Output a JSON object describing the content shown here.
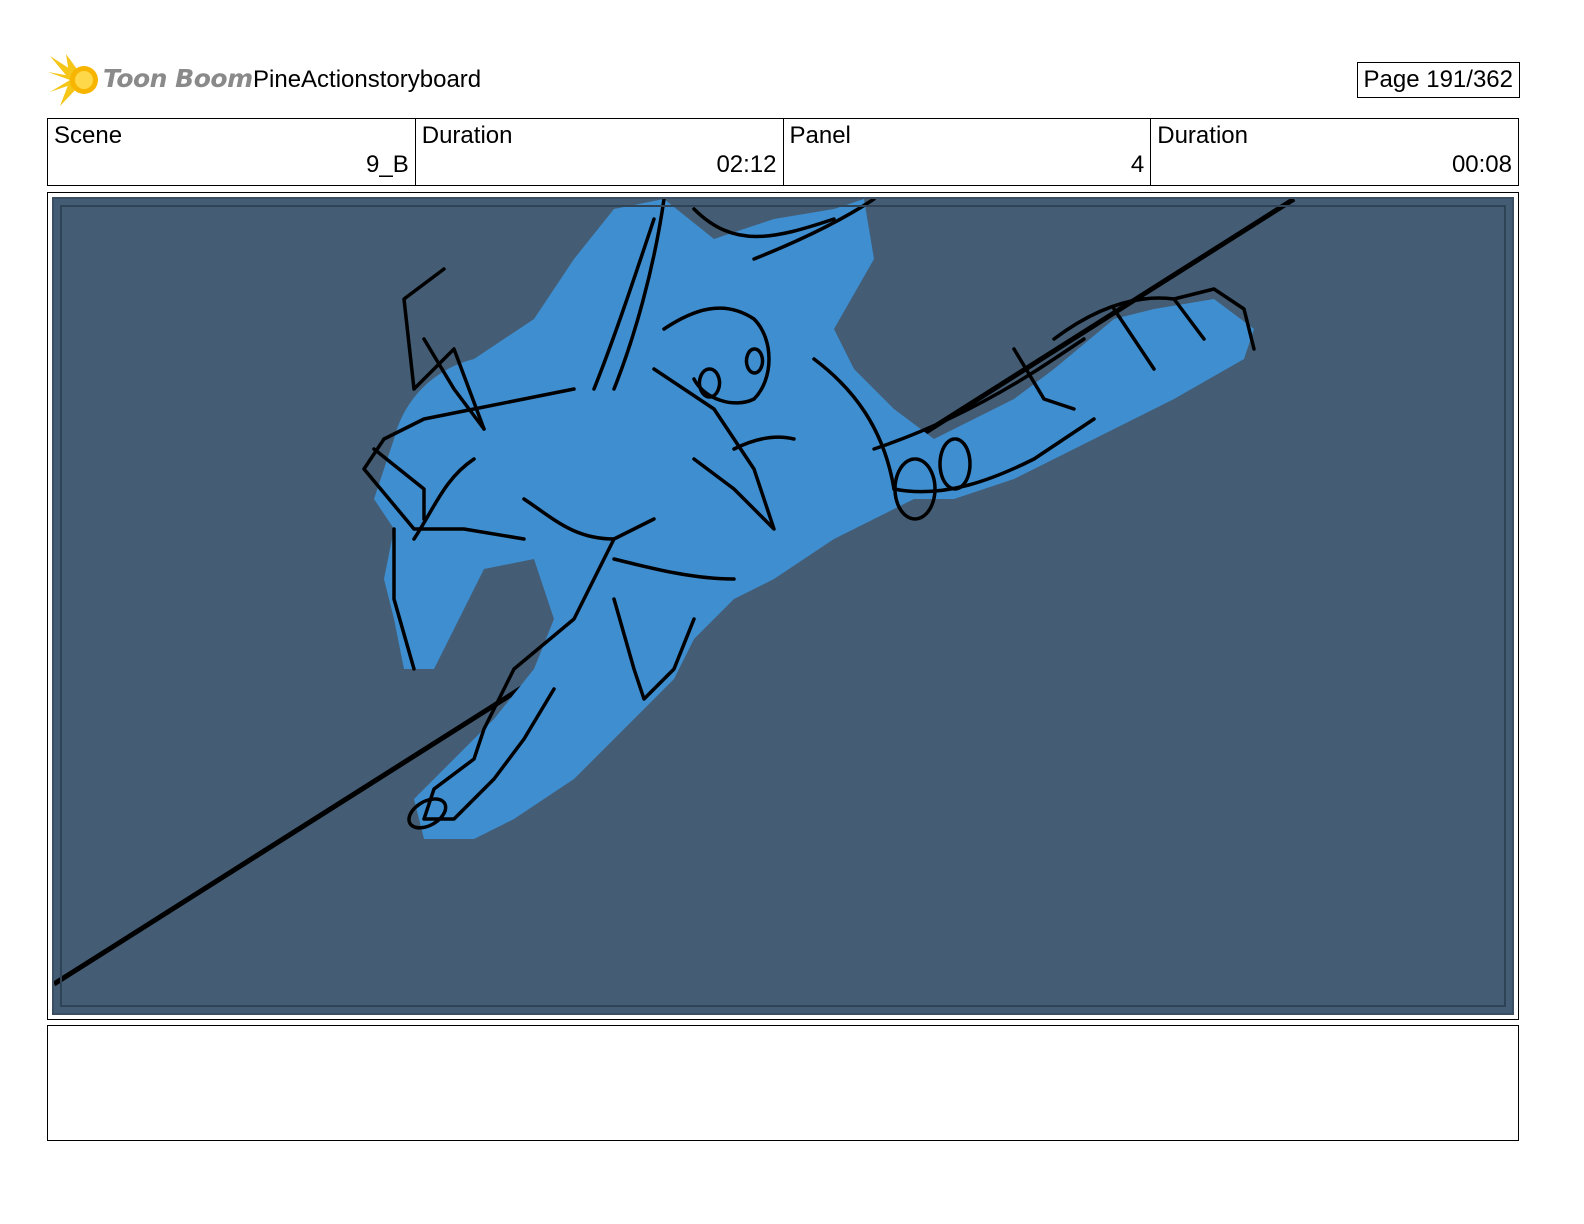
{
  "header": {
    "logo_text": "Toon Boom",
    "project_title": "PineActionstoryboard",
    "page_label": "Page 191/362"
  },
  "info": {
    "scene_label": "Scene",
    "scene_value": "9_B",
    "scene_duration_label": "Duration",
    "scene_duration_value": "02:12",
    "panel_label": "Panel",
    "panel_value": "4",
    "panel_duration_label": "Duration",
    "panel_duration_value": "00:08"
  },
  "colors": {
    "panel_background": "#445d74",
    "character_fill": "#3e8ed0",
    "line_ink": "#000000",
    "logo_accent": "#f5c518"
  },
  "notes": {
    "text": ""
  }
}
